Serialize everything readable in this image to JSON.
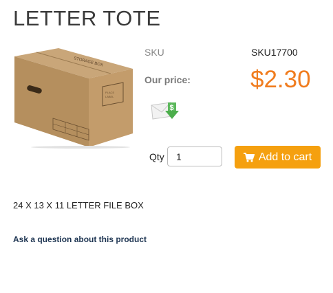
{
  "product": {
    "title": "LETTER TOTE",
    "sku_label": "SKU",
    "sku_value": "SKU17700",
    "price_label": "Our price:",
    "price_value": "$2.30",
    "description": "24 X 13 X 11 LETTER FILE BOX"
  },
  "cart": {
    "qty_label": "Qty",
    "qty_value": "1",
    "add_label": "Add to cart"
  },
  "links": {
    "ask_question": "Ask a question about this product"
  },
  "colors": {
    "price": "#f07c1e",
    "button": "#f5a00f",
    "link": "#1e3552"
  },
  "icons": [
    "email-price-alert-icon",
    "shopping-cart-icon"
  ]
}
